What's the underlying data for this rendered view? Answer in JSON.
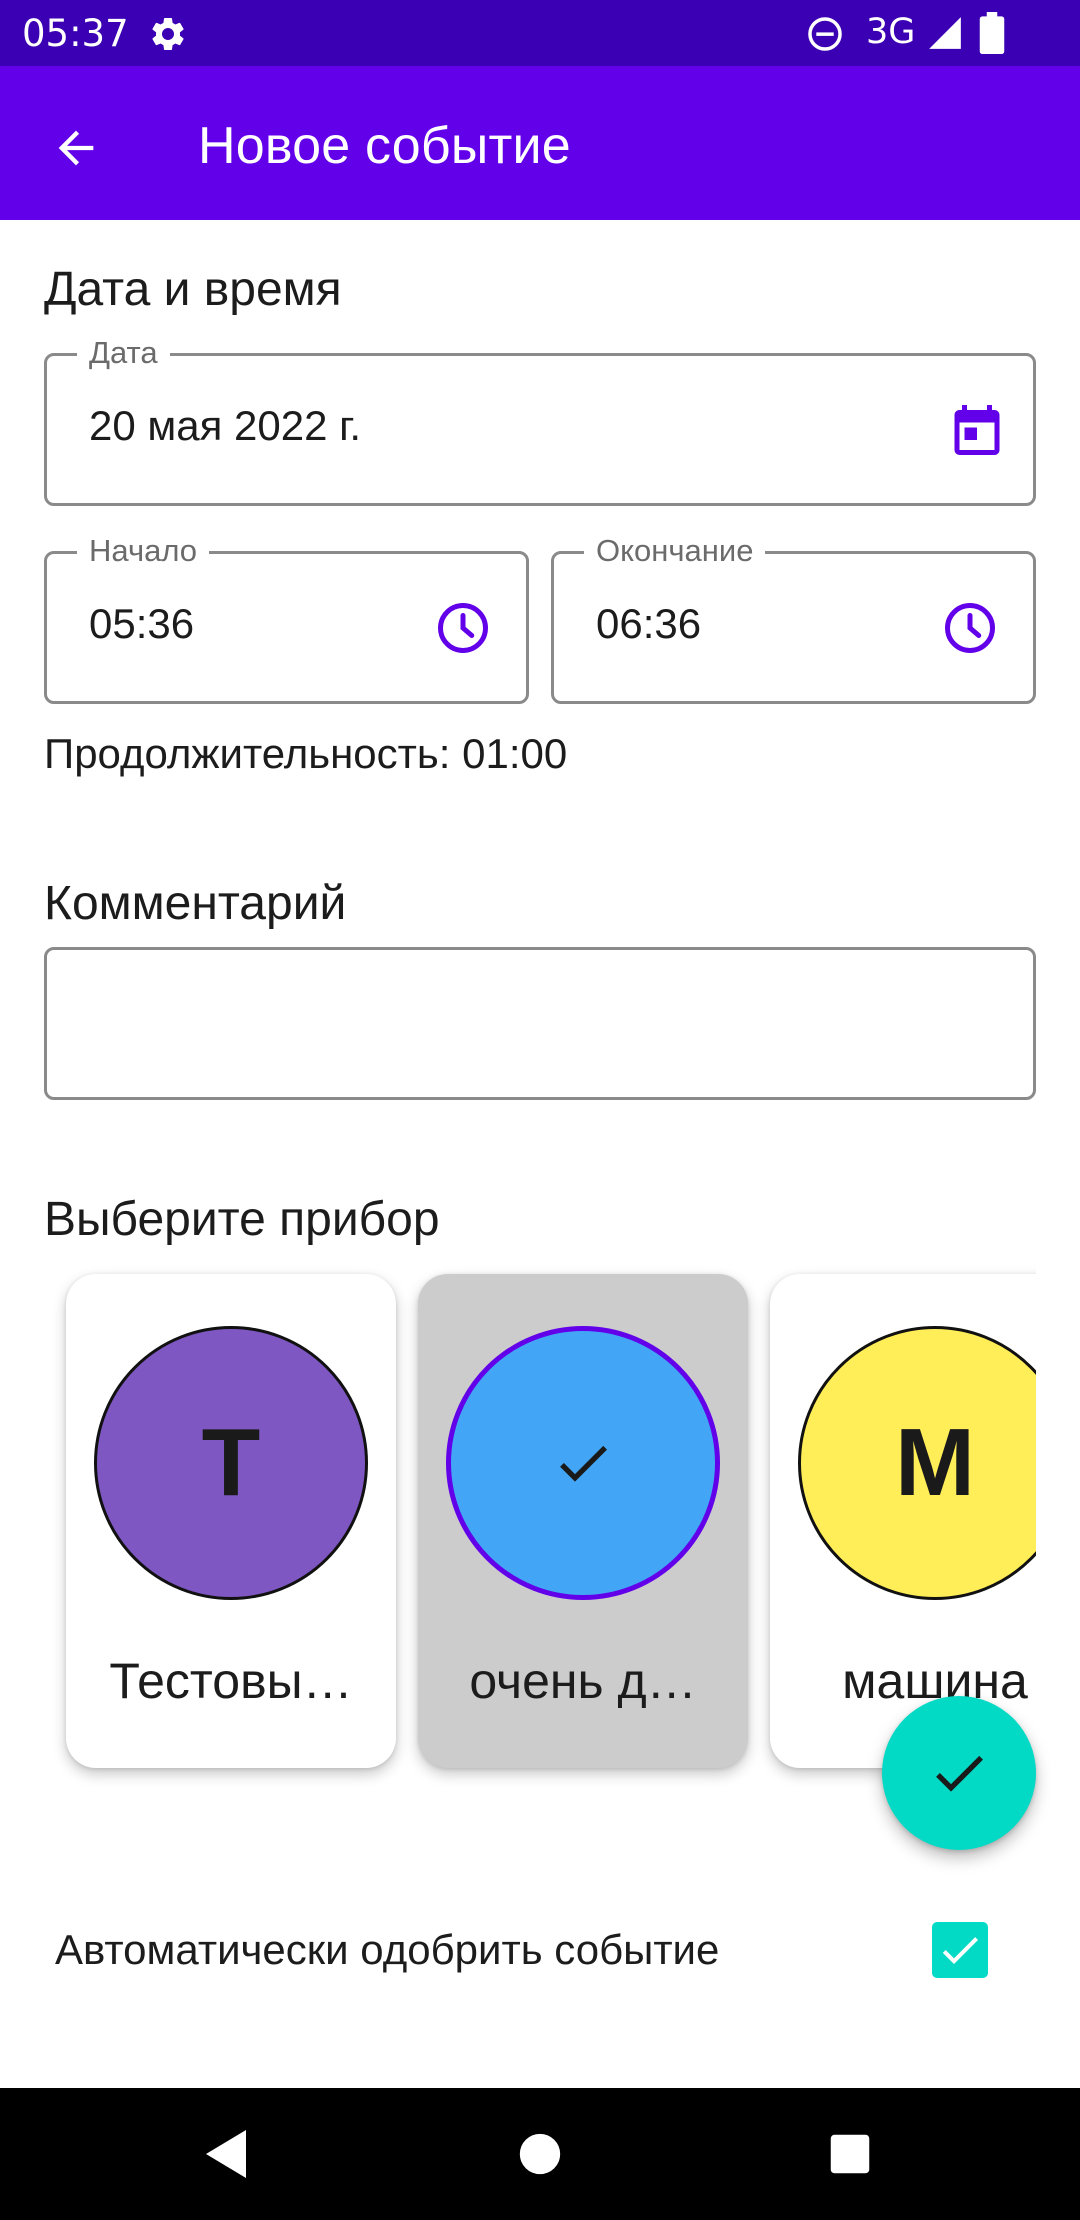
{
  "status_bar": {
    "time": "05:37",
    "network": "3G",
    "icons": [
      "gear-icon",
      "do-not-disturb-icon",
      "signal-icon",
      "battery-icon"
    ]
  },
  "app_bar": {
    "title": "Новое событие",
    "back_icon": "arrow-back-icon"
  },
  "date_time_section": {
    "title": "Дата и время",
    "date_field": {
      "label": "Дата",
      "value": "20 мая 2022 г.",
      "icon": "calendar-icon"
    },
    "start_field": {
      "label": "Начало",
      "value": "05:36",
      "icon": "clock-icon"
    },
    "end_field": {
      "label": "Окончание",
      "value": "06:36",
      "icon": "clock-icon"
    },
    "duration": "Продолжительность: 01:00"
  },
  "comment_section": {
    "title": "Комментарий",
    "value": ""
  },
  "device_section": {
    "title": "Выберите прибор",
    "devices": [
      {
        "initial": "T",
        "name": "Тестовы…",
        "color": "#7e57c2",
        "selected": false
      },
      {
        "initial": "",
        "name": "очень д…",
        "color": "#42a5f5",
        "selected": true
      },
      {
        "initial": "M",
        "name": "машина",
        "color": "#ffee58",
        "selected": false
      }
    ]
  },
  "fab": {
    "icon": "check-icon"
  },
  "auto_approve": {
    "label": "Автоматически одобрить событие",
    "checked": true
  },
  "colors": {
    "status_bar": "#3b00b3",
    "primary": "#6200ea",
    "accent": "#03dac5"
  },
  "nav_bar": {
    "icons": [
      "back-triangle-icon",
      "home-circle-icon",
      "recents-square-icon"
    ]
  }
}
